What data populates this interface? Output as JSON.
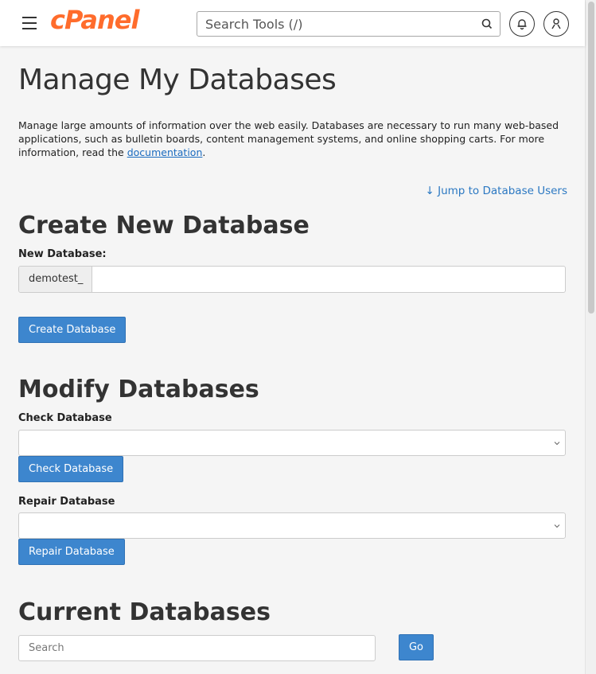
{
  "header": {
    "logo_text": "cPanel",
    "search_placeholder": "Search Tools (/)",
    "icons": [
      "menu-icon",
      "search-icon",
      "bell-icon",
      "user-icon"
    ],
    "colors": {
      "brand": "#ff6c2c",
      "primary_button": "#3d86ce",
      "link": "#2b78c2"
    }
  },
  "page": {
    "title": "Manage My Databases",
    "description_text": "Manage large amounts of information over the web easily. Databases are necessary to run many web-based applications, such as bulletin boards, content management systems, and online shopping carts. For more information, read the ",
    "description_link": "documentation",
    "description_end": ".",
    "jump_arrow": "↓",
    "jump_link": "Jump to Database Users"
  },
  "create": {
    "title": "Create New Database",
    "label": "New Database:",
    "prefix": "demotest_",
    "value": "",
    "button": "Create Database"
  },
  "modify": {
    "title": "Modify Databases",
    "check_label": "Check Database",
    "check_selected": "",
    "check_button": "Check Database",
    "repair_label": "Repair Database",
    "repair_selected": "",
    "repair_button": "Repair Database"
  },
  "current": {
    "title": "Current Databases",
    "search_placeholder": "Search",
    "go_button": "Go"
  }
}
